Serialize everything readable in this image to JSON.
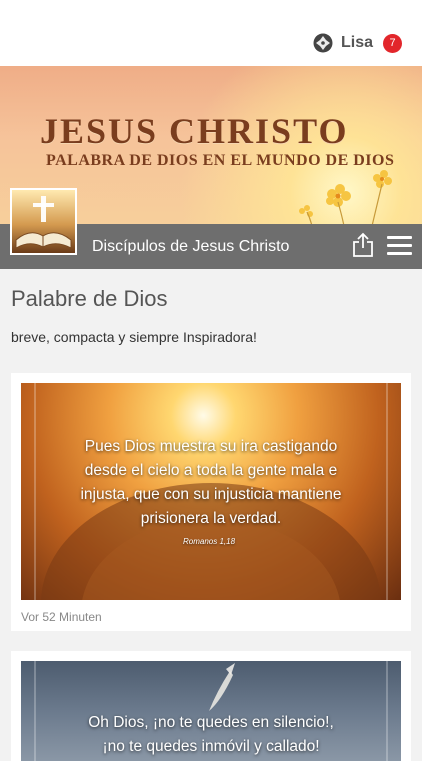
{
  "header": {
    "user_name": "Lisa",
    "notification_count": "7"
  },
  "banner": {
    "title": "JESUS CHRISTO",
    "subtitle": "PALABRA DE DIOS EN EL MUNDO DE DIOS"
  },
  "nav": {
    "title": "Discípulos  de Jesus Christo"
  },
  "section": {
    "title": "Palabre de Dios",
    "subtitle": "breve, compacta y siempre Inspiradora!"
  },
  "posts": [
    {
      "quote_lines": [
        "Pues Dios muestra su ira castigando",
        "desde el cielo a toda la gente mala e",
        "injusta, que con su injusticia mantiene",
        "prisionera la verdad."
      ],
      "reference": "Romanos 1,18",
      "time": "Vor 52 Minuten"
    },
    {
      "quote_lines": [
        "Oh Dios, ¡no te quedes en silencio!,",
        "¡no te quedes inmóvil y callado!"
      ]
    }
  ]
}
